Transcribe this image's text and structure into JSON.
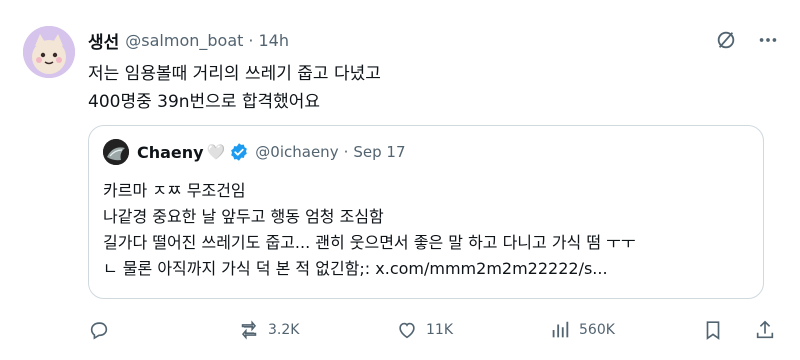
{
  "tweet": {
    "display_name": "생선",
    "handle": "@salmon_boat",
    "separator": "·",
    "time": "14h",
    "lines": [
      "저는 임용볼때 거리의 쓰레기 줍고 다녔고",
      "400명중 39n번으로 합격했어요"
    ]
  },
  "quote": {
    "display_name": "Chaeny",
    "heart": "🤍",
    "handle": "@0ichaeny",
    "separator": "·",
    "date": "Sep 17",
    "lines": [
      "카르마 ㅈㅉ  무조건임",
      "나같경 중요한 날 앞두고 행동 엄청 조심함",
      "길가다 떨어진 쓰레기도 줍고... 괜히 웃으면서 좋은 말 하고 다니고 가식 떰 ㅜㅜ",
      "ㄴ 물론 아직까지 가식 덕 본 적 없긴함;: x.com/mmm2m2m22222/s..."
    ]
  },
  "actions": {
    "reposts": "3.2K",
    "likes": "11K",
    "views": "560K"
  },
  "colors": {
    "text": "#0f1419",
    "secondary": "#536471",
    "border": "#cfd9de",
    "verified": "#1d9bf0"
  }
}
